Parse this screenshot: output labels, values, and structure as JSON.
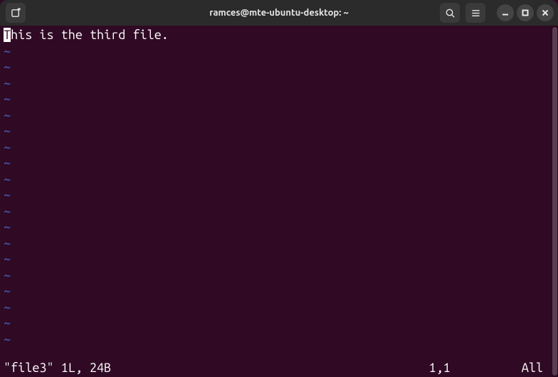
{
  "window": {
    "title": "ramces@mte-ubuntu-desktop: ~"
  },
  "editor": {
    "cursor_char": "T",
    "rest_of_line": "his is the third file.",
    "tilde": "~",
    "tilde_count": 19
  },
  "status": {
    "left": "\"file3\" 1L, 24B",
    "position": "1,1",
    "percent": "All"
  },
  "icons": {
    "newtab": "new-tab-icon",
    "search": "search-icon",
    "menu": "hamburger-icon",
    "minimize": "minimize-icon",
    "maximize": "maximize-icon",
    "close": "close-icon"
  }
}
